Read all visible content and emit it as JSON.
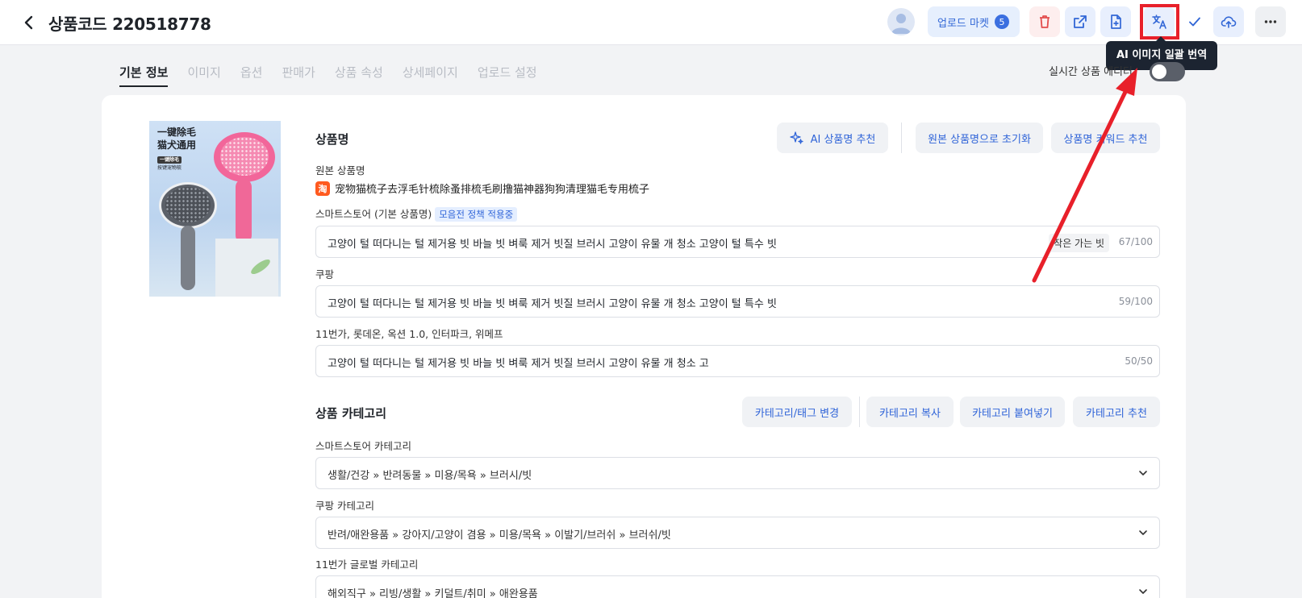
{
  "header": {
    "title": "상품코드 220518778",
    "upload_market_label": "업로드 마켓",
    "upload_market_count": "5"
  },
  "tooltip": {
    "text": "AI 이미지 일괄 번역"
  },
  "tabs": [
    {
      "label": "기본 정보",
      "active": true
    },
    {
      "label": "이미지"
    },
    {
      "label": "옵션"
    },
    {
      "label": "판매가"
    },
    {
      "label": "상품 속성"
    },
    {
      "label": "상세페이지"
    },
    {
      "label": "업로드 설정"
    }
  ],
  "preview": {
    "label": "실시간 상품 에디터"
  },
  "product_image": {
    "text_line1": "一键除毛",
    "text_line2": "猫犬通用",
    "text_line3": "一键除毛",
    "text_line4": "按键宠物梳"
  },
  "name_section": {
    "title": "상품명",
    "ai_button": "AI 상품명 추천",
    "reset_button": "원본 상품명으로 초기화",
    "keyword_button": "상품명 키워드 추천",
    "original_label": "원본 상품명",
    "original_source_icon": "淘",
    "original_name": "宠物猫梳子去浮毛针梳除蚤排梳毛刷撸猫神器狗狗清理猫毛专用梳子",
    "smartstore_label": "스마트스토어 (기본 상품명)",
    "smartstore_tag": "모음전 정책 적용중",
    "smartstore_value": "고양이 털 떠다니는 털 제거용 빗 바늘 빗 벼룩 제거 빗질 브러시 고양이 유물 개 청소 고양이 털 특수 빗",
    "smartstore_chip": "작은 가는 빗",
    "smartstore_count": "67/100",
    "coupang_label": "쿠팡",
    "coupang_value": "고양이 털 떠다니는 털 제거용 빗 바늘 빗 벼룩 제거 빗질 브러시 고양이 유물 개 청소 고양이 털 특수 빗",
    "coupang_count": "59/100",
    "eleven_label": "11번가, 롯데온, 옥션 1.0, 인터파크, 위메프",
    "eleven_value": "고양이 털 떠다니는 털 제거용 빗 바늘 빗 벼룩 제거 빗질 브러시 고양이 유물 개 청소 고",
    "eleven_count": "50/50"
  },
  "category_section": {
    "title": "상품 카테고리",
    "change_button": "카테고리/태그 변경",
    "copy_button": "카테고리 복사",
    "paste_button": "카테고리 붙여넣기",
    "recommend_button": "카테고리 추천",
    "smartstore_label": "스마트스토어 카테고리",
    "smartstore_value": "생활/건강 » 반려동물 » 미용/목욕 » 브러시/빗",
    "coupang_label": "쿠팡 카테고리",
    "coupang_value": "반려/애완용품 » 강아지/고양이 겸용 » 미용/목욕 » 이발기/브러쉬 » 브러쉬/빗",
    "global11_label": "11번가 글로벌 카테고리",
    "global11_value": "해외직구 » 리빙/생활 » 키덜트/취미 » 애완용품"
  },
  "colors": {
    "accent": "#2f64d8",
    "highlight": "#e8202a",
    "tooltip_bg": "#1c2431"
  },
  "icons": {
    "back": "chevron-left-icon",
    "delete": "trash-icon",
    "open": "external-link-icon",
    "add_file": "file-plus-icon",
    "translate": "translate-icon",
    "check": "check-icon",
    "upload": "cloud-upload-icon",
    "more": "more-horizontal-icon"
  }
}
